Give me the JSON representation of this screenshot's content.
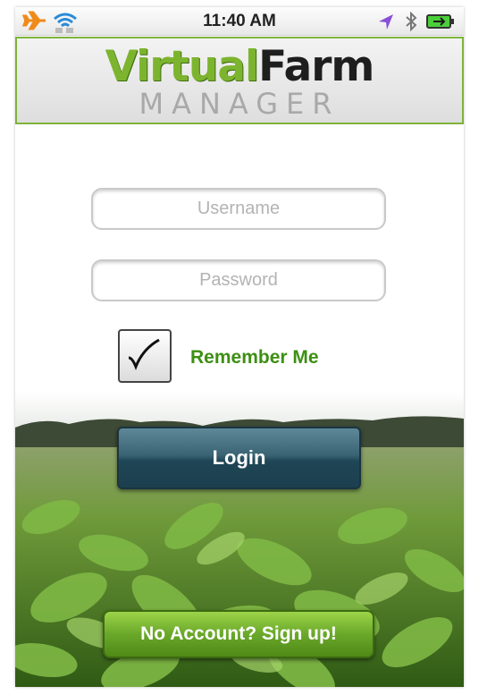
{
  "status_bar": {
    "time": "11:40 AM",
    "icons": [
      "airplane-icon",
      "wifi-icon",
      "location-arrow-icon",
      "bluetooth-icon",
      "battery-icon"
    ]
  },
  "header": {
    "logo_word1": "Virtual",
    "logo_word2": "Farm",
    "logo_subtitle": "MANAGER"
  },
  "login_form": {
    "username": {
      "value": "",
      "placeholder": "Username"
    },
    "password": {
      "value": "",
      "placeholder": "Password"
    },
    "remember_me": {
      "label": "Remember Me",
      "checked": true
    },
    "login_button_label": "Login"
  },
  "signup_button_label": "No Account? Sign up!",
  "colors": {
    "brand_green": "#7db42f",
    "label_green": "#3d8f12",
    "login_button": "#2b5564",
    "signup_button": "#6aa82a"
  }
}
